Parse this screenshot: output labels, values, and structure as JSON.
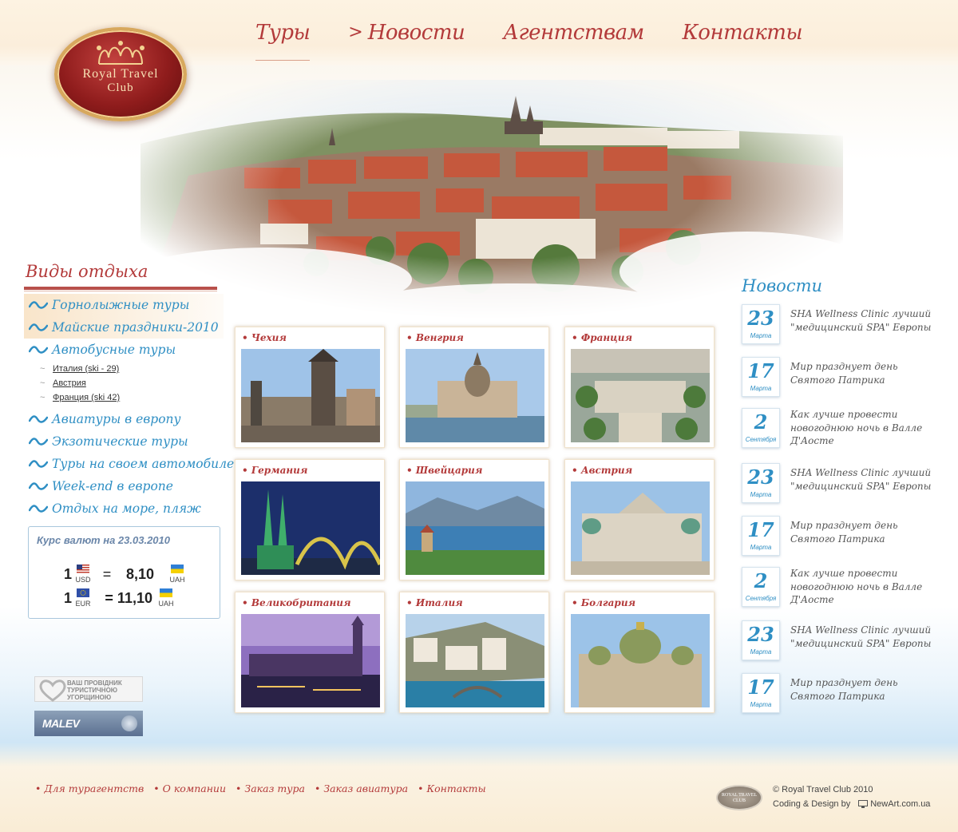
{
  "logo": {
    "line1": "Royal Travel",
    "line2": "Club"
  },
  "nav": {
    "items": [
      {
        "label": "Туры"
      },
      {
        "label": "Новости"
      },
      {
        "label": "Агентствам"
      },
      {
        "label": "Контакты"
      }
    ],
    "arrow": ">"
  },
  "sidebar": {
    "title": "Виды отдыха",
    "items": [
      {
        "label": "Горнолыжные туры"
      },
      {
        "label": "Майские праздники-2010"
      },
      {
        "label": "Автобусные туры"
      },
      {
        "label": "Авиатуры в европу"
      },
      {
        "label": "Экзотические туры"
      },
      {
        "label": "Туры на своем автомобиле"
      },
      {
        "label": "Week-end в европе"
      },
      {
        "label": "Отдых на море, пляж"
      }
    ],
    "sub_items": [
      {
        "label": "Италия (ski - 29)"
      },
      {
        "label": "Австрия"
      },
      {
        "label": "Франция (ski 42)"
      }
    ],
    "sub_marker": "~"
  },
  "currency": {
    "title": "Курс валют на 23.03.2010",
    "rows": [
      {
        "amount": "1",
        "from": "USD",
        "eq": "=",
        "value": "8,10",
        "to": "UAH"
      },
      {
        "amount": "1",
        "from": "EUR",
        "eq": "=",
        "value": "= 11,10",
        "to": "UAH"
      }
    ]
  },
  "badges": {
    "provider_text": [
      "ВАШ ПРОВІДНИК",
      "ТУРИСТИЧНОЮ",
      "УГОРЩИНОЮ"
    ],
    "malev": "MALEV"
  },
  "tours": [
    {
      "name": "Чехия"
    },
    {
      "name": "Венгрия"
    },
    {
      "name": "Франция"
    },
    {
      "name": "Германия"
    },
    {
      "name": "Швейцария"
    },
    {
      "name": "Австрия"
    },
    {
      "name": "Великобритания"
    },
    {
      "name": "Италия"
    },
    {
      "name": "Болгария"
    }
  ],
  "tour_bullet": "•",
  "news": {
    "title": "Новости",
    "items": [
      {
        "day": "23",
        "month": "Марта",
        "text": "SHA Wellness Clinic лучший \"медицинский SPA\" Европы"
      },
      {
        "day": "17",
        "month": "Марта",
        "text": "Мир празднует день Святого Патрика"
      },
      {
        "day": "2",
        "month": "Сентября",
        "text": "Как лучше провести новогоднюю ночь в Валле Д'Аосте"
      },
      {
        "day": "23",
        "month": "Марта",
        "text": "SHA Wellness Clinic лучший \"медицинский SPA\" Европы"
      },
      {
        "day": "17",
        "month": "Марта",
        "text": "Мир празднует день Святого Патрика"
      },
      {
        "day": "2",
        "month": "Сентября",
        "text": "Как лучше провести новогоднюю ночь в Валле Д'Аосте"
      },
      {
        "day": "23",
        "month": "Марта",
        "text": "SHA Wellness Clinic лучший \"медицинский SPA\" Европы"
      },
      {
        "day": "17",
        "month": "Марта",
        "text": "Мир празднует день Святого Патрика"
      }
    ]
  },
  "footer": {
    "links": [
      {
        "label": "Для турагентств"
      },
      {
        "label": "О компании"
      },
      {
        "label": "Заказ тура"
      },
      {
        "label": "Заказ авиатура"
      },
      {
        "label": "Контакты"
      }
    ],
    "bullet": "•",
    "logo_text": [
      "ROYAL TRAVEL",
      "CLUB"
    ],
    "copyright": "© Royal Travel Club 2010",
    "coding_label": "Coding & Design by",
    "coding_site": "NewArt.com.ua"
  },
  "colors": {
    "accent_red": "#b33a3a",
    "accent_blue": "#2f8fc4",
    "cream": "#fbeedb"
  }
}
